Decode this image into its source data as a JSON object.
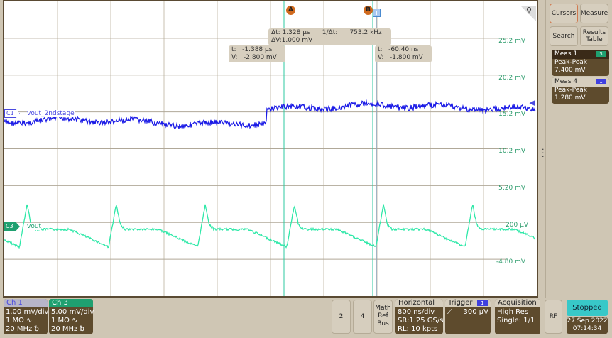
{
  "plot": {
    "y_labels": [
      "25.2 mV",
      "20.2 mV",
      "15.2 mV",
      "10.2 mV",
      "5.20 mV",
      "200 µV",
      "-4.80 mV"
    ],
    "cursor_a": "A",
    "cursor_b": "B",
    "trigger_marker": "T",
    "delta": {
      "dt": "Δt: 1.328 µs",
      "inv_dt_label": "1/Δt:",
      "inv_dt": "753.2 kHz",
      "dv": "ΔV:1.000 mV"
    },
    "cursor_a_readout": {
      "t": "t:   -1.388 µs",
      "v": "V:   -2.800 mV"
    },
    "cursor_b_readout": {
      "t": "t:   -60.40 ns",
      "v": "V:   -1.800 mV"
    },
    "ch1": {
      "tag": "C1",
      "label": "vout_2ndstage",
      "color": "#1a1ae6"
    },
    "ch3": {
      "tag": "C3",
      "label": "vout",
      "color": "#2ee8a8"
    }
  },
  "sidebar": {
    "cursors": "Cursors",
    "measure": "Measure",
    "search": "Search",
    "results_table": "Results Table",
    "meas": [
      {
        "title": "Meas 1",
        "ch": "3",
        "ch_color": "#1fa070",
        "type": "Peak-Peak",
        "value": "7.400 mV"
      },
      {
        "title": "Meas 4",
        "ch": "1",
        "ch_color": "#4040e0",
        "type": "Peak-Peak",
        "value": "1.280 mV"
      }
    ]
  },
  "bottom": {
    "ch1": {
      "title": "Ch 1",
      "scale": "1.00 mV/div",
      "imp": "1 MΩ ∿",
      "bw": "20 MHz ␢"
    },
    "ch3": {
      "title": "Ch 3",
      "scale": "5.00 mV/div",
      "imp": "1 MΩ ∿",
      "bw": "20 MHz ␢"
    },
    "btn2": "2",
    "btn4": "4",
    "math": "Math Ref Bus",
    "horizontal": {
      "title": "Horizontal",
      "scale": "800 ns/div",
      "sr": "SR:1.25 GS/s",
      "rl": "RL: 10 kpts"
    },
    "trigger": {
      "title": "Trigger",
      "ch": "1",
      "slope": "⟋",
      "level": "300 µV"
    },
    "acquisition": {
      "title": "Acquisition",
      "mode": "High Res",
      "single": "Single: 1/1"
    },
    "rf": "RF",
    "status": "Stopped",
    "date": "27 Sep 2022",
    "time": "07:14:34"
  }
}
